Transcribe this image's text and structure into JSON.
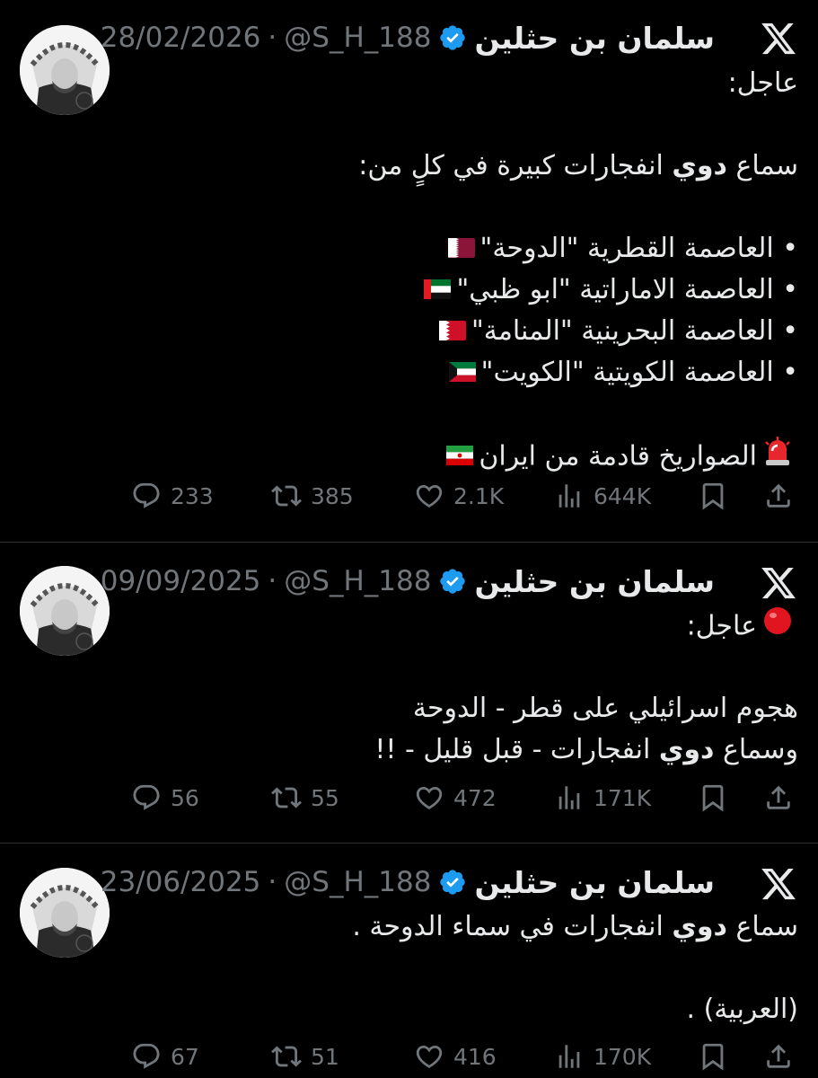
{
  "tweets": [
    {
      "name": "سلمان بن حثلين",
      "handle": "@S_H_188",
      "separator": "·",
      "date": "28/02/2026",
      "lines": [
        {
          "text": "عاجل:"
        },
        {
          "blank": true
        },
        {
          "pre": "سماع ",
          "bold": "دوي",
          "post": " انفجارات كبيرة في كلٍ من:"
        },
        {
          "blank": true
        },
        {
          "text": "• العاصمة القطرية \"الدوحة\"",
          "flag": "qatar-flag-icon"
        },
        {
          "text": "• العاصمة الاماراتية \"ابو ظبي\"",
          "flag": "uae-flag-icon"
        },
        {
          "text": "• العاصمة البحرينية \"المنامة\"",
          "flag": "bahrain-flag-icon"
        },
        {
          "text": "• العاصمة الكويتية \"الكويت\"",
          "flag": "kuwait-flag-icon"
        },
        {
          "blank": true
        },
        {
          "text": "الصواريخ قادمة من ايران",
          "lead": "siren-icon",
          "flag": "iran-flag-icon"
        }
      ],
      "replies": "233",
      "reposts": "385",
      "likes": "2.1K",
      "views": "644K"
    },
    {
      "name": "سلمان بن حثلين",
      "handle": "@S_H_188",
      "separator": "·",
      "date": "09/09/2025",
      "lines": [
        {
          "text": "عاجل:",
          "lead": "red-circle-icon"
        },
        {
          "blank": true
        },
        {
          "text": "هجوم اسرائيلي على قطر - الدوحة"
        },
        {
          "pre": "وسماع ",
          "bold": "دوي",
          "post": " انفجارات - قبل قليل - !!"
        }
      ],
      "replies": "56",
      "reposts": "55",
      "likes": "472",
      "views": "171K"
    },
    {
      "name": "سلمان بن حثلين",
      "handle": "@S_H_188",
      "separator": "·",
      "date": "23/06/2025",
      "lines": [
        {
          "pre": "سماع ",
          "bold": "دوي",
          "post": " انفجارات في سماء الدوحة ."
        },
        {
          "blank": true
        },
        {
          "text": "(العربية) ."
        }
      ],
      "replies": "67",
      "reposts": "51",
      "likes": "416",
      "views": "170K"
    }
  ],
  "colors": {
    "background": "#000000",
    "text": "#e7e9ea",
    "muted": "#71767b",
    "verified": "#1d9bf0",
    "divider": "#2f3336"
  }
}
